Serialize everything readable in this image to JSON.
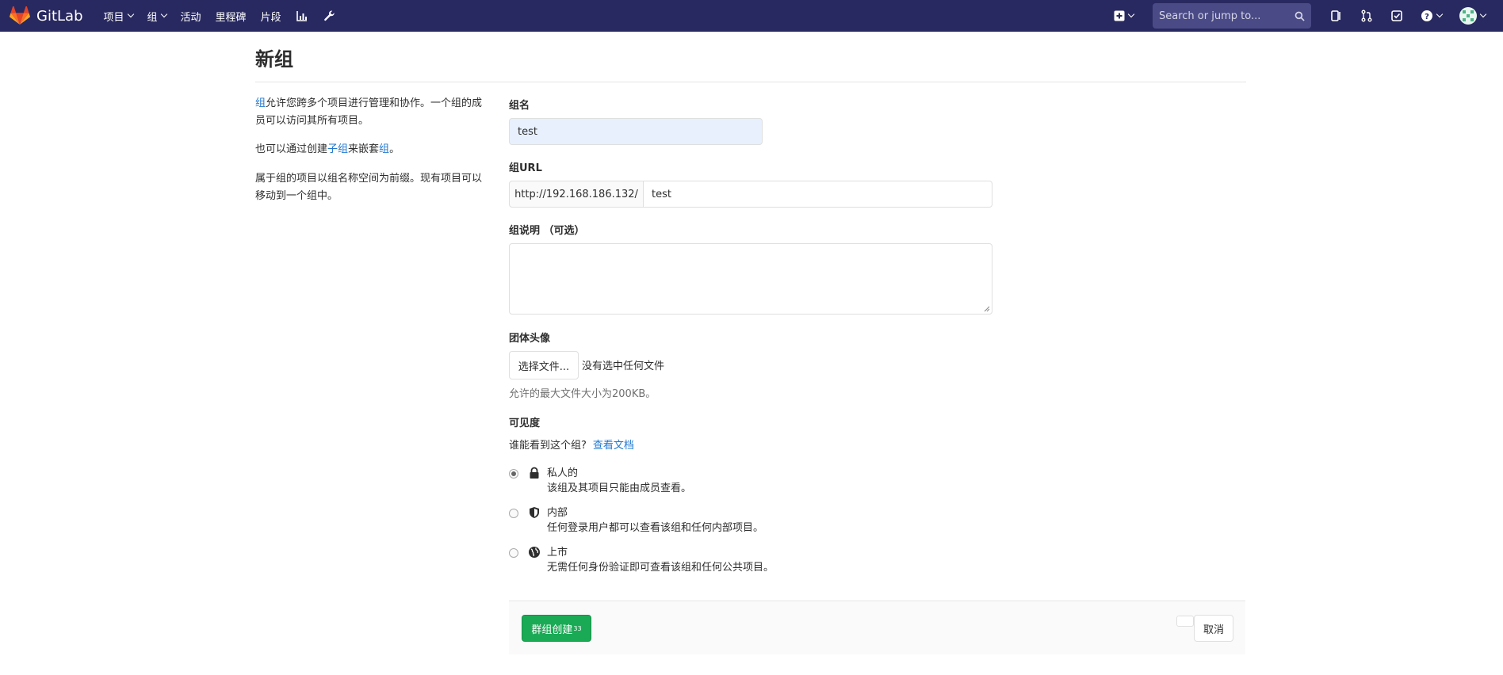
{
  "navbar": {
    "logo_text": "GitLab",
    "links": [
      "项目",
      "组",
      "活动",
      "里程碑",
      "片段"
    ],
    "search_placeholder": "Search or jump to..."
  },
  "page": {
    "title": "新组"
  },
  "sidebar": {
    "p1_link": "组",
    "p1_text": "允许您跨多个项目进行管理和协作。一个组的成员可以访问其所有项目。",
    "p2_a": "也可以通过创建",
    "p2_link1": "子组",
    "p2_b": "来嵌套",
    "p2_link2": "组",
    "p2_c": "。",
    "p3_text": "属于组的项目以组名称空间为前缀。现有项目可以移动到一个组中。"
  },
  "form": {
    "name_label": "组名",
    "name_value": "test",
    "url_label": "组URL",
    "url_prefix": "http://192.168.186.132/",
    "url_value": "test",
    "desc_label": "组说明 （可选）",
    "avatar_label": "团体头像",
    "file_button": "选择文件...",
    "file_status": "没有选中任何文件",
    "file_hint": "允许的最大文件大小为200KB。",
    "visibility_label": "可见度",
    "who_text": "谁能看到这个组?",
    "docs_link": "查看文档",
    "options": [
      {
        "title": "私人的",
        "desc": "该组及其项目只能由成员查看。",
        "checked": true
      },
      {
        "title": "内部",
        "desc": "任何登录用户都可以查看该组和任何内部项目。",
        "checked": false
      },
      {
        "title": "上市",
        "desc": "无需任何身份验证即可查看该组和任何公共项目。",
        "checked": false
      }
    ],
    "create_button": "群组创建",
    "create_sup": "33",
    "cancel_button": "取消"
  },
  "colors": {
    "navbar": "#292961",
    "link": "#1f78d1",
    "create_button": "#1aaa55"
  }
}
